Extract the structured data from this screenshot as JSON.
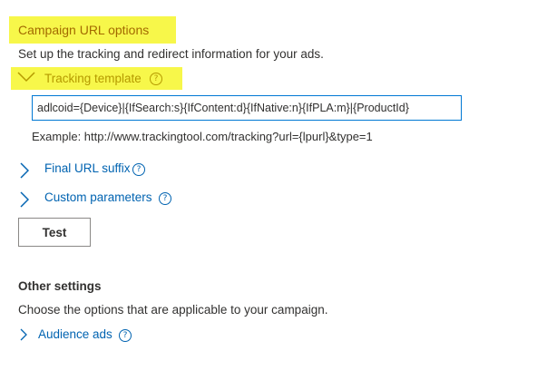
{
  "campaign_url": {
    "title": "Campaign URL options",
    "description": "Set up the tracking and redirect information for your ads."
  },
  "tracking_template": {
    "label": "Tracking template",
    "help_icon": "help-circle-icon",
    "value": "adlcoid={Device}|{IfSearch:s}{IfContent:d}{IfNative:n}{IfPLA:m}|{ProductId}",
    "example": "Example: http://www.trackingtool.com/tracking?url={lpurl}&type=1"
  },
  "final_url_suffix": {
    "label": "Final URL suffix"
  },
  "custom_parameters": {
    "label": "Custom parameters"
  },
  "test_button": {
    "label": "Test"
  },
  "other_settings": {
    "title": "Other settings",
    "description": "Choose the options that are applicable to your campaign."
  },
  "audience_ads": {
    "label": "Audience ads"
  },
  "help_glyph": "?",
  "colors": {
    "highlight": "#f7f74a",
    "link": "#0063b1",
    "input_border": "#0078d4",
    "title": "#a36a00"
  }
}
